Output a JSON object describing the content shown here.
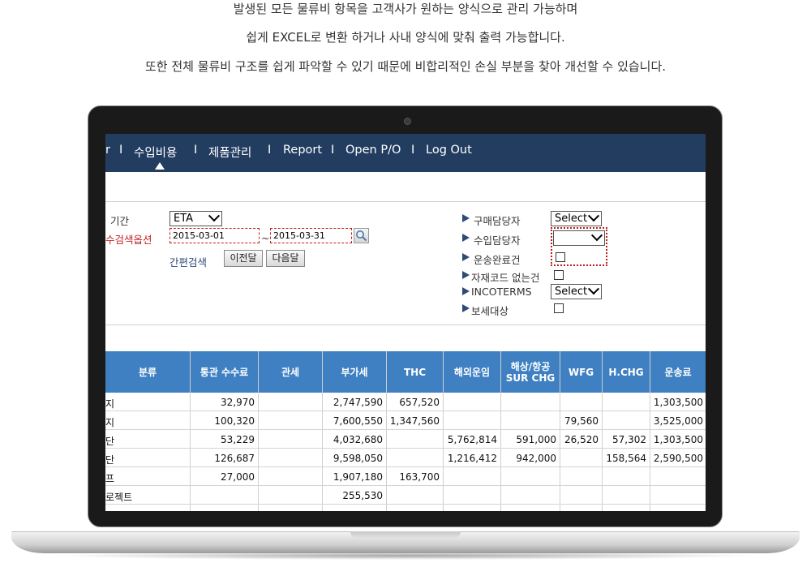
{
  "intro": {
    "line1": "발생된 모든 물류비 항목을 고객사가 원하는 양식으로 관리 가능하며",
    "line2": "쉽게 EXCEL로 변환 하거나 사내 양식에 맞춰 출력 가능합니다.",
    "line3": "또한 전체 물류비 구조를 쉽게 파악할 수 있기 때문에 비합리적인 손실 부분을 찾아 개선할 수 있습니다."
  },
  "nav": {
    "items": [
      "r",
      "수입비용",
      "제품관리",
      "Report",
      "Open P/O",
      "Log Out"
    ],
    "separator": "I",
    "active_index": 1
  },
  "search": {
    "period_label": "기간",
    "period_value": "ETA",
    "option_label": "수검색옵션",
    "date_from": "2015-03-01",
    "date_to": "2015-03-31",
    "tilde": "~",
    "quick_label": "간편검색",
    "prev_button": "이전달",
    "next_button": "다음달",
    "right": {
      "buyer_label": "구매담당자",
      "buyer_value": "Select",
      "importer_label": "수입담당자",
      "importer_value": "",
      "shipping_done_label": "운송완료건",
      "no_material_label": "자재코드 없는건",
      "incoterms_label": "INCOTERMS",
      "incoterms_value": "Select",
      "bonded_label": "보세대상"
    }
  },
  "table": {
    "headers": [
      "분류",
      "통관 수수료",
      "관세",
      "부가세",
      "THC",
      "해외운임",
      "해상/항공\nSUR CHG",
      "WFG",
      "H.CHG",
      "운송료"
    ],
    "rows": [
      [
        "지",
        "32,970",
        "",
        "2,747,590",
        "657,520",
        "",
        "",
        "",
        "",
        "1,303,500"
      ],
      [
        "지",
        "100,320",
        "",
        "7,600,550",
        "1,347,560",
        "",
        "",
        "79,560",
        "",
        "3,525,000"
      ],
      [
        "단",
        "53,229",
        "",
        "4,032,680",
        "",
        "5,762,814",
        "591,000",
        "26,520",
        "57,302",
        "1,303,500"
      ],
      [
        "단",
        "126,687",
        "",
        "9,598,050",
        "",
        "1,216,412",
        "942,000",
        "",
        "158,564",
        "2,590,500"
      ],
      [
        "프",
        "27,000",
        "",
        "1,907,180",
        "163,700",
        "",
        "",
        "",
        "",
        ""
      ],
      [
        "로젝트",
        "",
        "",
        "255,530",
        "",
        "",
        "",
        "",
        "",
        ""
      ],
      [
        "",
        "",
        "",
        "",
        "",
        "",
        "",
        "",
        "",
        ""
      ]
    ]
  }
}
